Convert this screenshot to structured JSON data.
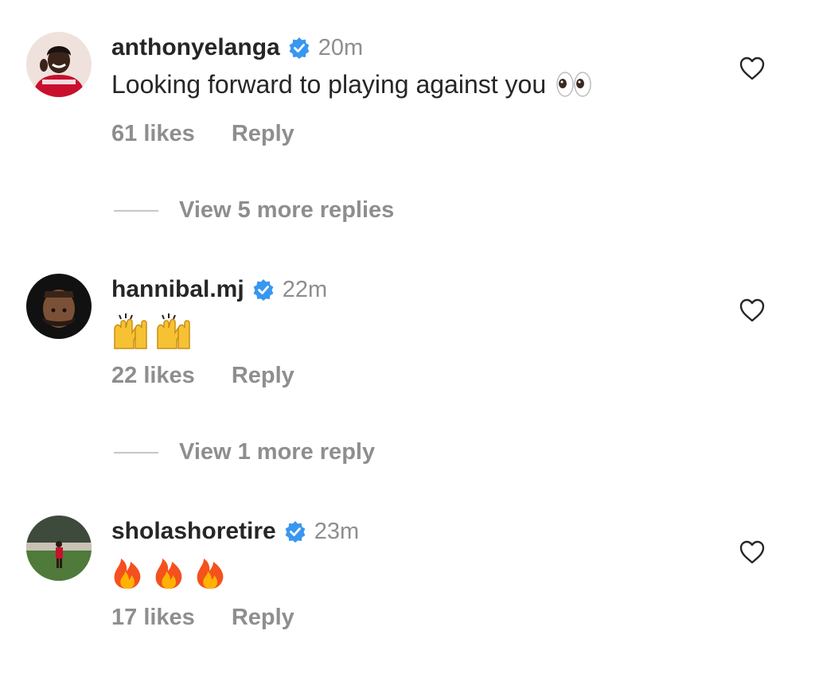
{
  "comments": [
    {
      "username": "anthonyelanga",
      "time": "20m",
      "text": "Looking forward to playing against you",
      "emoji": "eyes",
      "likes": "61 likes",
      "reply": "Reply",
      "view_more": "View 5 more replies",
      "verified": true
    },
    {
      "username": "hannibal.mj",
      "time": "22m",
      "text": "",
      "emoji": "raising-hands",
      "likes": "22 likes",
      "reply": "Reply",
      "view_more": "View 1 more reply",
      "verified": true
    },
    {
      "username": "sholashoretire",
      "time": "23m",
      "text": "",
      "emoji": "fire",
      "likes": "17 likes",
      "reply": "Reply",
      "verified": true
    }
  ],
  "icons": {
    "verified": "verified-badge-icon",
    "like": "heart-outline-icon"
  },
  "colors": {
    "username": "#262626",
    "muted": "#8e8e8e",
    "verified": "#3897f0",
    "divider": "#c7c7c7"
  }
}
